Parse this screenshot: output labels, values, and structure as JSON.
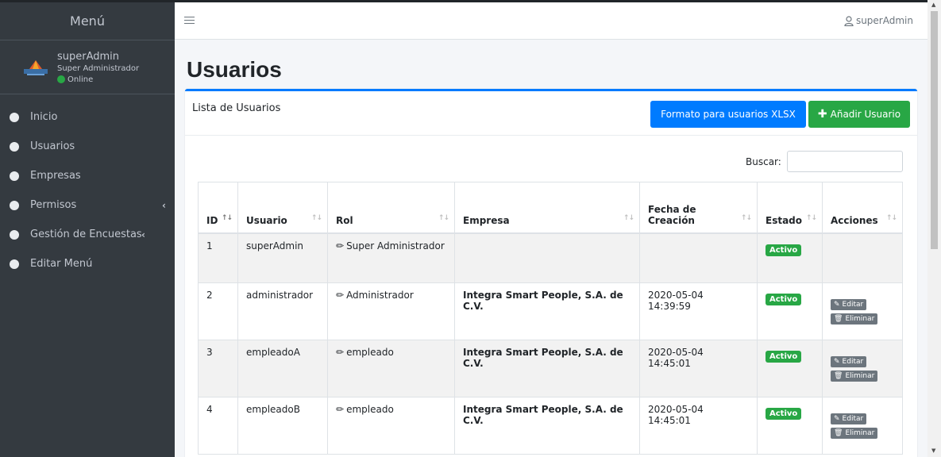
{
  "sidebar": {
    "brand": "Menú",
    "user": {
      "name": "superAdmin",
      "role": "Super Administrador",
      "status": "Online"
    },
    "items": [
      {
        "label": "Inicio",
        "has_arrow": false
      },
      {
        "label": "Usuarios",
        "has_arrow": false
      },
      {
        "label": "Empresas",
        "has_arrow": false
      },
      {
        "label": "Permisos",
        "has_arrow": true
      },
      {
        "label": "Gestión de Encuestas",
        "has_arrow": true
      },
      {
        "label": "Editar Menú",
        "has_arrow": false
      }
    ],
    "arrow": "‹"
  },
  "topbar": {
    "user": "superAdmin"
  },
  "page": {
    "title": "Usuarios"
  },
  "card": {
    "title": "Lista de Usuarios",
    "btn_format": "Formato para usuarios XLSX",
    "btn_add": "Añadir Usuario"
  },
  "search": {
    "label": "Buscar:",
    "value": ""
  },
  "table": {
    "headers": [
      "ID",
      "Usuario",
      "Rol",
      "Empresa",
      "Fecha de Creación",
      "Estado",
      "Acciones"
    ],
    "rows": [
      {
        "id": "1",
        "usuario": "superAdmin",
        "rol": "Super Administrador",
        "empresa": "",
        "fecha": "",
        "estado": "Activo",
        "actions": false
      },
      {
        "id": "2",
        "usuario": "administrador",
        "rol": "Administrador",
        "empresa": "Integra Smart People, S.A. de C.V.",
        "fecha": "2020-05-04 14:39:59",
        "estado": "Activo",
        "actions": true
      },
      {
        "id": "3",
        "usuario": "empleadoA",
        "rol": "empleado",
        "empresa": "Integra Smart People, S.A. de C.V.",
        "fecha": "2020-05-04 14:45:01",
        "estado": "Activo",
        "actions": true
      },
      {
        "id": "4",
        "usuario": "empleadoB",
        "rol": "empleado",
        "empresa": "Integra Smart People, S.A. de C.V.",
        "fecha": "2020-05-04 14:45:01",
        "estado": "Activo",
        "actions": true
      }
    ],
    "edit_label": "Editar",
    "delete_label": "Eliminar"
  },
  "colors": {
    "sidebar": "#343a40",
    "primary": "#007bff",
    "success": "#28a745",
    "secondary": "#6c757d"
  }
}
